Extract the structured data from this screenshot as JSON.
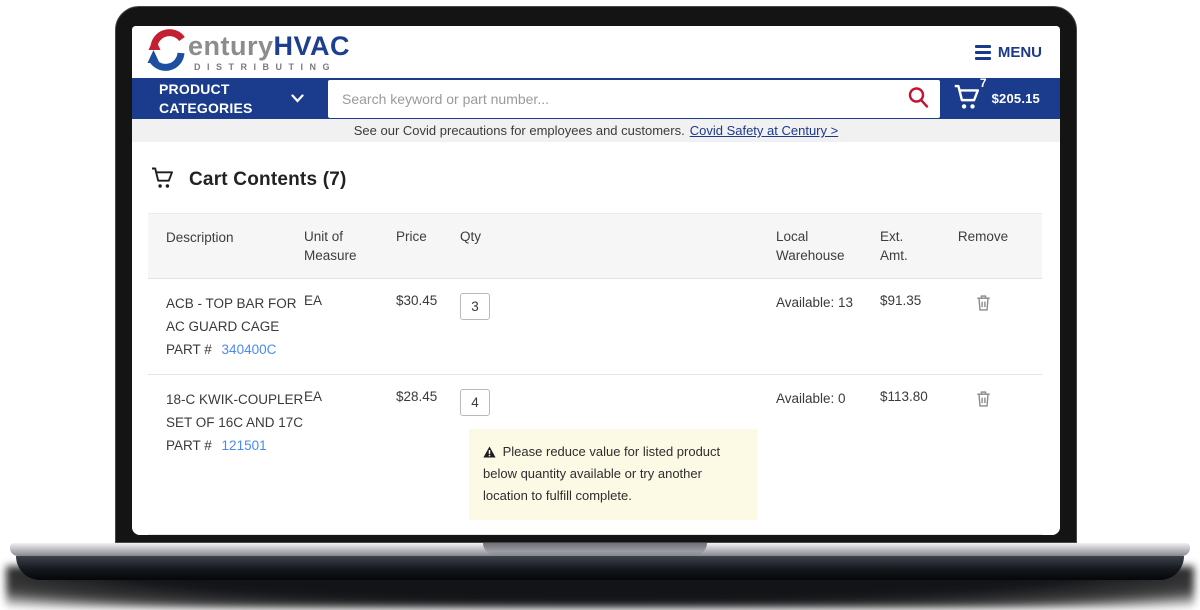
{
  "header": {
    "logo": {
      "century_suffix": "entury",
      "hvac": "HVAC",
      "tagline": "DISTRIBUTING"
    },
    "menu_label": "MENU"
  },
  "nav": {
    "product_categories_label": "PRODUCT CATEGORIES",
    "search_placeholder": "Search keyword or part number...",
    "cart_count": "7",
    "cart_total": "$205.15"
  },
  "banner": {
    "text": "See our Covid precautions for employees and customers.",
    "link": "Covid Safety at Century >"
  },
  "cart": {
    "title": "Cart Contents (7)",
    "columns": [
      "Description",
      "Unit of Measure",
      "Price",
      "Qty",
      "Local Warehouse",
      "Ext. Amt.",
      "Remove"
    ],
    "rows": [
      {
        "description": "ACB - TOP BAR FOR AC GUARD CAGE",
        "part_label": "PART #",
        "part_number": "340400C",
        "uom": "EA",
        "price": "$30.45",
        "qty": "3",
        "warehouse": "Available: 13",
        "ext_amt": "$91.35"
      },
      {
        "description": "18-C KWIK-COUPLER SET OF 16C AND 17C",
        "part_label": "PART #",
        "part_number": "121501",
        "uom": "EA",
        "price": "$28.45",
        "qty": "4",
        "warehouse": "Available: 0",
        "ext_amt": "$113.80",
        "warning": "Please reduce value for listed product below quantity available or try another location to fulfill complete."
      }
    ]
  },
  "colors": {
    "navy": "#1b3c8c",
    "logo_red": "#c32032",
    "logo_blue": "#1d4fa0",
    "search_icon_red": "#c41432",
    "part_link_blue": "#4a8af4",
    "warning_bg": "#fcf9e5"
  }
}
